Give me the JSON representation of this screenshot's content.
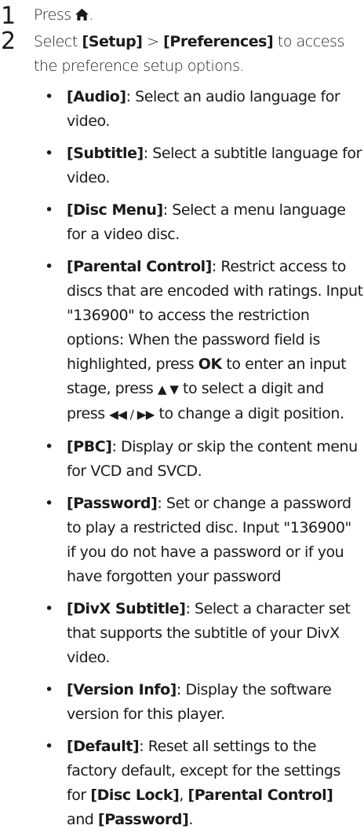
{
  "steps": [
    {
      "number": "1",
      "text": "Press ",
      "home_icon": "home-icon",
      "suffix": "."
    },
    {
      "number": "2",
      "text_select": "Select ",
      "setup": "[Setup]",
      "gt": " > ",
      "preferences": "[Preferences]",
      "text_rest": " to access the preference setup options."
    }
  ],
  "bullet_glyph": "•",
  "items": [
    {
      "term": "[Audio]",
      "desc": ": Select an audio language for video."
    },
    {
      "term": "[Subtitle]",
      "desc": ": Select a subtitle language for video."
    },
    {
      "term": "[Disc Menu]",
      "desc": ": Select a menu language for a video disc."
    },
    {
      "term": "[Parental Control]",
      "desc1": ": Restrict access to discs that are encoded with ratings. Input \"136900\" to access the restriction options: When the password field is highlighted, press ",
      "ok": "OK",
      "desc2": " to enter an input stage, press ",
      "updown": "▲ ▼",
      "desc3": " to select a digit and press ",
      "leftright": "◀◀ / ▶▶",
      "desc4": " to change a digit position."
    },
    {
      "term": "[PBC]",
      "desc": ": Display or skip the content menu for VCD and SVCD."
    },
    {
      "term": "[Password]",
      "desc": ": Set or change a password to play a restricted disc. Input \"136900\" if you do not have a password or if you have forgotten your password"
    },
    {
      "term": "[DivX Subtitle]",
      "desc": ": Select a character set that supports the subtitle of your DivX video."
    },
    {
      "term": "[Version Info]",
      "desc": ": Display the software version for this player."
    },
    {
      "term": "[Default]",
      "desc1": ": Reset all settings to the factory default, except for the settings for ",
      "disc_lock": "[Disc Lock]",
      "comma": ", ",
      "parental": "[Parental Control]",
      "and": " and ",
      "password": "[Password]",
      "period": "."
    }
  ]
}
